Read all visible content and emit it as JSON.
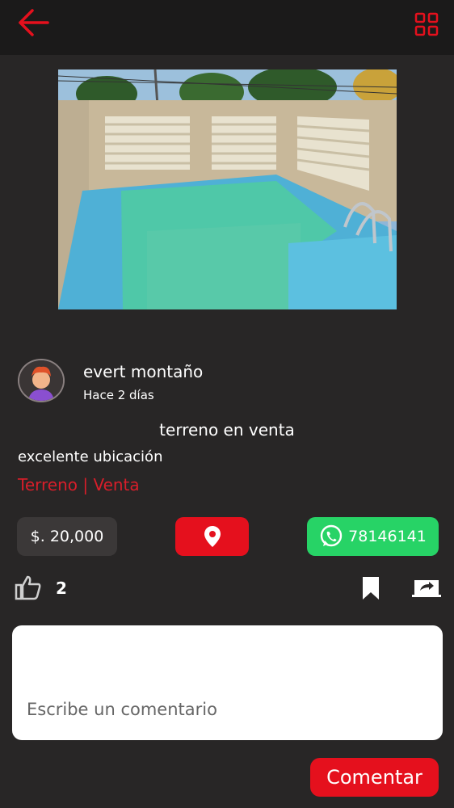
{
  "header": {
    "back_icon": "arrow-left-icon",
    "menu_icon": "grid-icon",
    "accent_color": "#e5101d"
  },
  "post": {
    "author_name": "evert montaño",
    "time_ago": "Hace 2 días",
    "title": "terreno en venta",
    "description": "excelente ubicación",
    "category": "Terreno | Venta",
    "price": "$. 20,000",
    "whatsapp_number": "78146141",
    "likes": "2"
  },
  "comment": {
    "placeholder": "Escribe un comentario",
    "submit_label": "Comentar"
  }
}
